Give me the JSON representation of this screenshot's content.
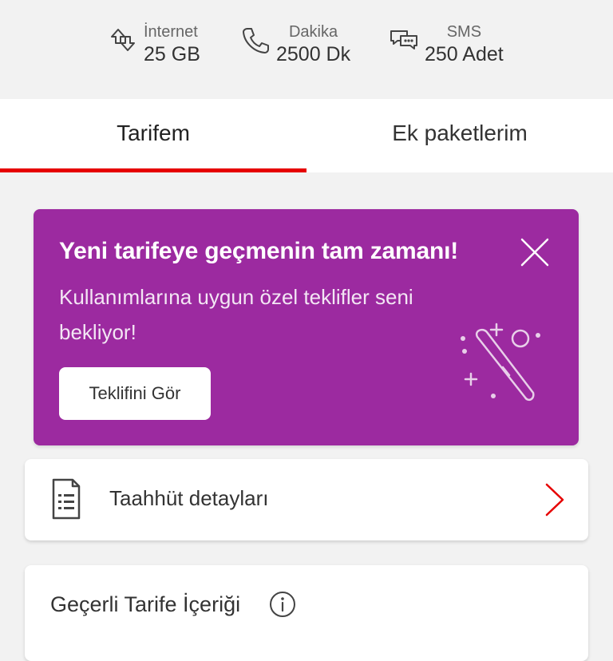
{
  "usage": {
    "internet": {
      "label": "İnternet",
      "value": "25 GB",
      "icon": "data-transfer-icon"
    },
    "dakika": {
      "label": "Dakika",
      "value": "2500 Dk",
      "icon": "phone-icon"
    },
    "sms": {
      "label": "SMS",
      "value": "250 Adet",
      "icon": "chat-bubbles-icon"
    }
  },
  "tabs": [
    {
      "label": "Tarifem",
      "active": true
    },
    {
      "label": "Ek paketlerim",
      "active": false
    }
  ],
  "promo": {
    "title": "Yeni tarifeye geçmenin tam zamanı!",
    "body": "Kullanımlarına uygun özel teklifler seni bekliyor!",
    "button_label": "Teklifini Gör",
    "background": "#9c2aa0",
    "close_icon": "close-icon",
    "illustration_icon": "magic-wand-icon"
  },
  "commitment": {
    "label": "Taahhüt detayları",
    "icon": "document-list-icon",
    "chevron": "chevron-right-icon"
  },
  "tariff": {
    "title": "Geçerli Tarife İçeriği",
    "info_icon": "info-icon"
  },
  "colors": {
    "accent": "#e60000",
    "promo_purple": "#9c2aa0"
  }
}
